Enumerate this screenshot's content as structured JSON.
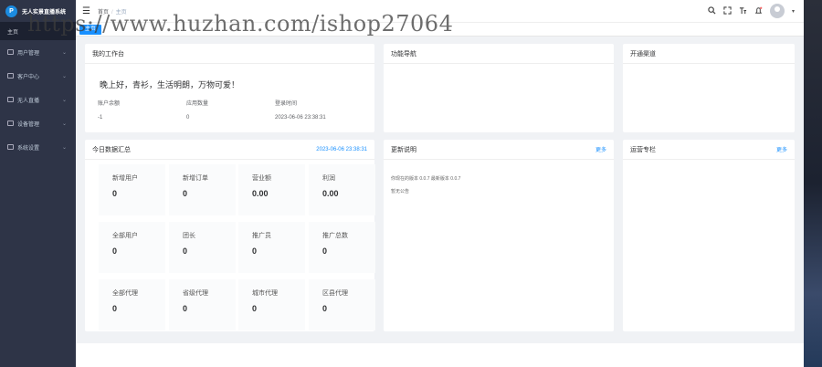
{
  "sidebar": {
    "title": "无人实景直播系统",
    "logo_text": "P",
    "home": "主页",
    "items": [
      {
        "label": "用户管理"
      },
      {
        "label": "客户中心"
      },
      {
        "label": "无人直播"
      },
      {
        "label": "设备管理"
      },
      {
        "label": "系统设置"
      }
    ]
  },
  "header": {
    "breadcrumb_home": "首页",
    "breadcrumb_sep": "/",
    "breadcrumb_current": "主页"
  },
  "tags": {
    "active": "主页"
  },
  "workbench": {
    "title": "我的工作台",
    "greeting": "晚上好，青衫，生活明朗，万物可爱！",
    "col1_label": "账户余额",
    "col2_label": "应用数量",
    "col3_label": "登录时间",
    "col1_value": "-1",
    "col2_value": "0",
    "col3_value": "2023-06-06 23:38:31"
  },
  "quicknav": {
    "title": "功能导航"
  },
  "channel": {
    "title": "开通渠道"
  },
  "stats": {
    "title": "今日数据汇总",
    "date": "2023-06-06 23:38:31",
    "items": [
      {
        "label": "新增用户",
        "value": "0"
      },
      {
        "label": "新增订单",
        "value": "0"
      },
      {
        "label": "营业额",
        "value": "0.00"
      },
      {
        "label": "利润",
        "value": "0.00"
      },
      {
        "label": "全部用户",
        "value": "0"
      },
      {
        "label": "团长",
        "value": "0"
      },
      {
        "label": "推广员",
        "value": "0"
      },
      {
        "label": "推广总数",
        "value": "0"
      },
      {
        "label": "全部代理",
        "value": "0"
      },
      {
        "label": "省级代理",
        "value": "0"
      },
      {
        "label": "城市代理",
        "value": "0"
      },
      {
        "label": "区县代理",
        "value": "0"
      }
    ]
  },
  "update": {
    "title": "更新说明",
    "more": "更多",
    "line1": "你现在的版本 0.0.7 最新版本 0.0.7",
    "line2": "暂无公告"
  },
  "tutorial": {
    "title": "运营专栏",
    "more": "更多"
  },
  "watermark": "https://www.huzhan.com/ishop27064"
}
